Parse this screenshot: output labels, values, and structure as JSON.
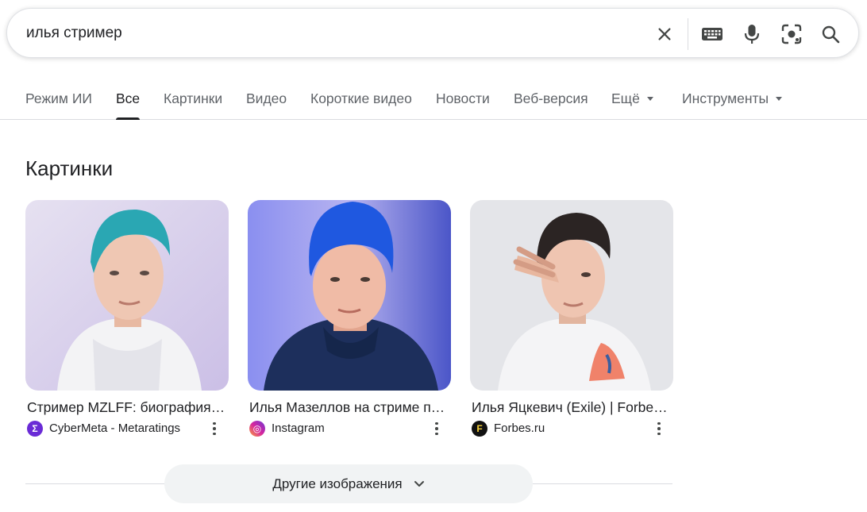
{
  "search": {
    "query": "илья стример",
    "icons": [
      "close-icon",
      "keyboard-icon",
      "microphone-icon",
      "lens-camera-icon",
      "search-icon"
    ]
  },
  "tabs": [
    {
      "label": "Режим ИИ"
    },
    {
      "label": "Все"
    },
    {
      "label": "Картинки"
    },
    {
      "label": "Видео"
    },
    {
      "label": "Короткие видео"
    },
    {
      "label": "Новости"
    },
    {
      "label": "Веб-версия"
    },
    {
      "label": "Ещё"
    },
    {
      "label": "Инструменты"
    }
  ],
  "active_tab": "Все",
  "images_section": {
    "title": "Картинки",
    "results": [
      {
        "title": "Стример MZLFF: биография…",
        "source": "CyberMeta - Metaratings",
        "favicon_letter": "Σ",
        "favicon_color": "#6a2bd6"
      },
      {
        "title": "Илья Мазеллов на стриме п…",
        "source": "Instagram",
        "favicon_letter": "◎",
        "favicon_color": "#d6249f"
      },
      {
        "title": "Илья Яцкевич (Exile) | Forbe…",
        "source": "Forbes.ru",
        "favicon_letter": "F",
        "favicon_color": "#111111"
      }
    ],
    "more_button": "Другие изображения"
  },
  "colors": {
    "accent_text": "#202124",
    "muted_text": "#5f6368",
    "divider": "#dadce0",
    "button_bg": "#f1f3f4"
  }
}
